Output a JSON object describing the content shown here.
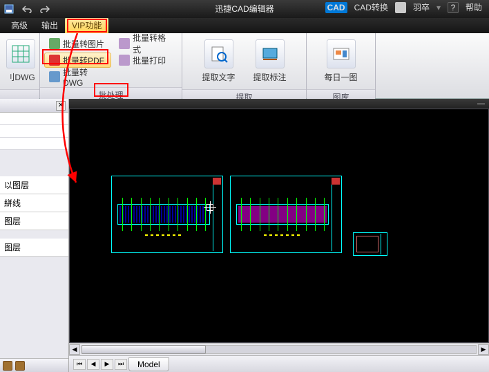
{
  "titlebar": {
    "app_title": "迅捷CAD编辑器",
    "convert": "CAD转换",
    "user": "羽卒",
    "help": "帮助"
  },
  "menu": {
    "t0": "高级",
    "t1": "输出",
    "t2": "VIP功能"
  },
  "ribbon": {
    "g1": {
      "b0": "刂DWG"
    },
    "g2": {
      "b0": "批量转图片",
      "b1": "批量转格式",
      "b2": "批量转PDF",
      "b3": "批量打印",
      "b4": "批量转DWG",
      "label": "批处理"
    },
    "g3": {
      "b0": "提取文字",
      "b1": "提取标注",
      "label": "提取"
    },
    "g4": {
      "b0": "每日一图",
      "label": "图库"
    }
  },
  "layers": {
    "l0": "以图层",
    "l1": "絣线",
    "l2": "图层",
    "l3": "图层"
  },
  "tabs": {
    "model": "Model"
  }
}
